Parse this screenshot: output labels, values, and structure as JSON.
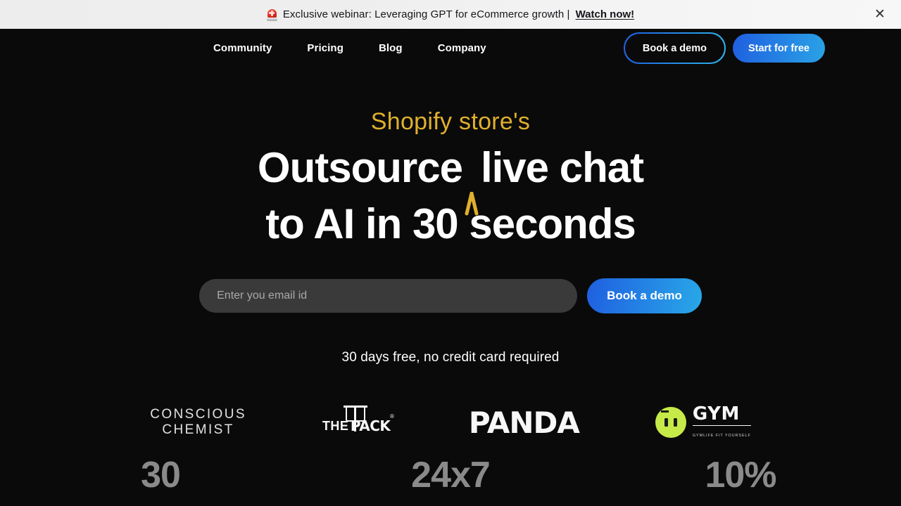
{
  "banner": {
    "icon": "siren-icon",
    "text": "Exclusive webinar: Leveraging GPT for eCommerce growth |",
    "link_label": "Watch now!",
    "close_label": "✕"
  },
  "nav": {
    "links": [
      {
        "label": "Community"
      },
      {
        "label": "Pricing"
      },
      {
        "label": "Blog"
      },
      {
        "label": "Company"
      }
    ],
    "book_demo_label": "Book a demo",
    "start_free_label": "Start for free"
  },
  "hero": {
    "eyebrow": "Shopify store's",
    "headline_line1_a": "Outsource",
    "headline_line1_b": "live chat",
    "headline_line2": "to AI in 30 seconds",
    "email_placeholder": "Enter you email id",
    "email_value": "",
    "cta_label": "Book a demo",
    "subtext": "30 days free, no credit card required"
  },
  "logos": [
    {
      "name": "conscious-chemist",
      "line1": "CONSCIOUS",
      "line2": "CHEMIST"
    },
    {
      "name": "the-pack",
      "the": "THE",
      "pack": "PACK",
      "registered": "®"
    },
    {
      "name": "panda",
      "label": "PANDA"
    },
    {
      "name": "gym",
      "label": "GYM",
      "tagline": "GYMLIFE FIT YOURSELF"
    }
  ],
  "stats": [
    {
      "value": "30"
    },
    {
      "value": "24x7"
    },
    {
      "value": "10%"
    }
  ],
  "colors": {
    "page_bg": "#0a0a0a",
    "banner_bg": "#eeeeee",
    "accent_gold": "#e0b02c",
    "accent_blue": "#1f5fe0",
    "accent_cyan": "#29a8e8",
    "gym_green": "#cdf249",
    "stat_grey": "#8a8a8a"
  }
}
